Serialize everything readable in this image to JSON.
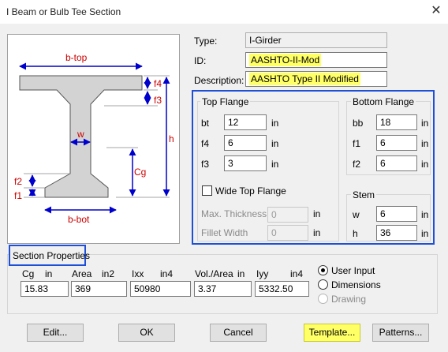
{
  "window": {
    "title": "I Beam or Bulb Tee Section",
    "close_glyph": "✕"
  },
  "diagram": {
    "labels": {
      "b_top": "b-top",
      "b_bot": "b-bot",
      "f4": "f4",
      "f3": "f3",
      "w": "w",
      "h": "h",
      "cg": "Cg",
      "f2": "f2",
      "f1": "f1"
    },
    "colors": {
      "dim": "#cc0000",
      "arrow": "#0000cc",
      "fill": "#d3d3d3"
    }
  },
  "info": {
    "type_label": "Type:",
    "type_value": "I-Girder",
    "id_label": "ID:",
    "id_value": "AASHTO-II-Mod",
    "desc_label": "Description:",
    "desc_value": "AASHTO Type II Modified"
  },
  "top_flange": {
    "title": "Top Flange",
    "rows": [
      {
        "label": "bt",
        "value": "12",
        "unit": "in"
      },
      {
        "label": "f4",
        "value": "6",
        "unit": "in"
      },
      {
        "label": "f3",
        "value": "3",
        "unit": "in"
      }
    ],
    "wide_label": "Wide Top Flange",
    "max_thickness_label": "Max. Thickness",
    "max_thickness_value": "0",
    "max_thickness_unit": "in",
    "fillet_width_label": "Fillet Width",
    "fillet_width_value": "0",
    "fillet_width_unit": "in"
  },
  "bottom_flange": {
    "title": "Bottom Flange",
    "rows": [
      {
        "label": "bb",
        "value": "18",
        "unit": "in"
      },
      {
        "label": "f1",
        "value": "6",
        "unit": "in"
      },
      {
        "label": "f2",
        "value": "6",
        "unit": "in"
      }
    ]
  },
  "stem": {
    "title": "Stem",
    "rows": [
      {
        "label": "w",
        "value": "6",
        "unit": "in"
      },
      {
        "label": "h",
        "value": "36",
        "unit": "in"
      }
    ]
  },
  "section_properties": {
    "title": "Section Properties",
    "columns": [
      {
        "name": "Cg",
        "unit": "in",
        "value": "15.83"
      },
      {
        "name": "Area",
        "unit": "in2",
        "value": "369"
      },
      {
        "name": "Ixx",
        "unit": "in4",
        "value": "50980"
      },
      {
        "name": "Vol./Area",
        "unit": "in",
        "value": "3.37"
      },
      {
        "name": "Iyy",
        "unit": "in4",
        "value": "5332.50"
      }
    ],
    "options": [
      {
        "label": "User Input",
        "selected": true
      },
      {
        "label": "Dimensions",
        "selected": false
      },
      {
        "label": "Drawing",
        "selected": false,
        "disabled": true
      }
    ]
  },
  "buttons": {
    "edit": "Edit...",
    "ok": "OK",
    "cancel": "Cancel",
    "template": "Template...",
    "patterns": "Patterns..."
  },
  "colors": {
    "highlight": "#ffff66",
    "callout": "#1f4fd6"
  }
}
